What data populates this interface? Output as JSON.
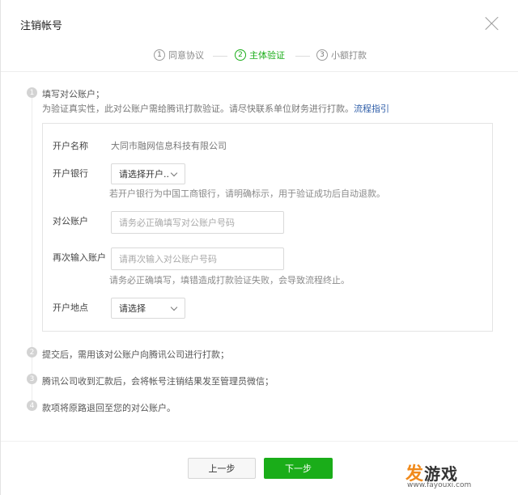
{
  "dialog": {
    "title": "注销帐号"
  },
  "steps": [
    {
      "num": "1",
      "label": "同意协议"
    },
    {
      "num": "2",
      "label": "主体验证"
    },
    {
      "num": "3",
      "label": "小额打款"
    }
  ],
  "timeline": [
    {
      "num": "1",
      "title": "填写对公账户；",
      "desc": "为验证真实性，此对公账户需给腾讯打款验证。请尽快联系单位财务进行打款。",
      "link": "流程指引"
    },
    {
      "num": "2",
      "title": "提交后，需用该对公账户向腾讯公司进行打款；"
    },
    {
      "num": "3",
      "title": "腾讯公司收到汇款后，会将帐号注销结果发至管理员微信；"
    },
    {
      "num": "4",
      "title": "款项将原路退回至您的对公账户。"
    }
  ],
  "form": {
    "account_name": {
      "label": "开户名称",
      "value": "大同市融网信息科技有限公司"
    },
    "bank": {
      "label": "开户银行",
      "selected": "请选择开户..",
      "hint": "若开户银行为中国工商银行，请明确标示，用于验证成功后自动退款。"
    },
    "account": {
      "label": "对公账户",
      "placeholder": "请务必正确填写对公账户号码"
    },
    "account_confirm": {
      "label": "再次输入账户",
      "placeholder": "请再次输入对公账户号码",
      "hint": "请务必正确填写，填错造成打款验证失败，会导致流程终止。"
    },
    "location": {
      "label": "开户地点",
      "selected": "请选择"
    }
  },
  "buttons": {
    "prev": "上一步",
    "next": "下一步"
  },
  "watermark": {
    "brand_accent": "发",
    "brand_rest": "游戏",
    "url": "www.fayouxi.com"
  },
  "colors": {
    "accent": "#1aad19",
    "link": "#2f5ea8",
    "watermark_orange": "#f08a1c"
  },
  "icons": {
    "close": "close-icon",
    "dropdown": "chevron-down-icon"
  }
}
